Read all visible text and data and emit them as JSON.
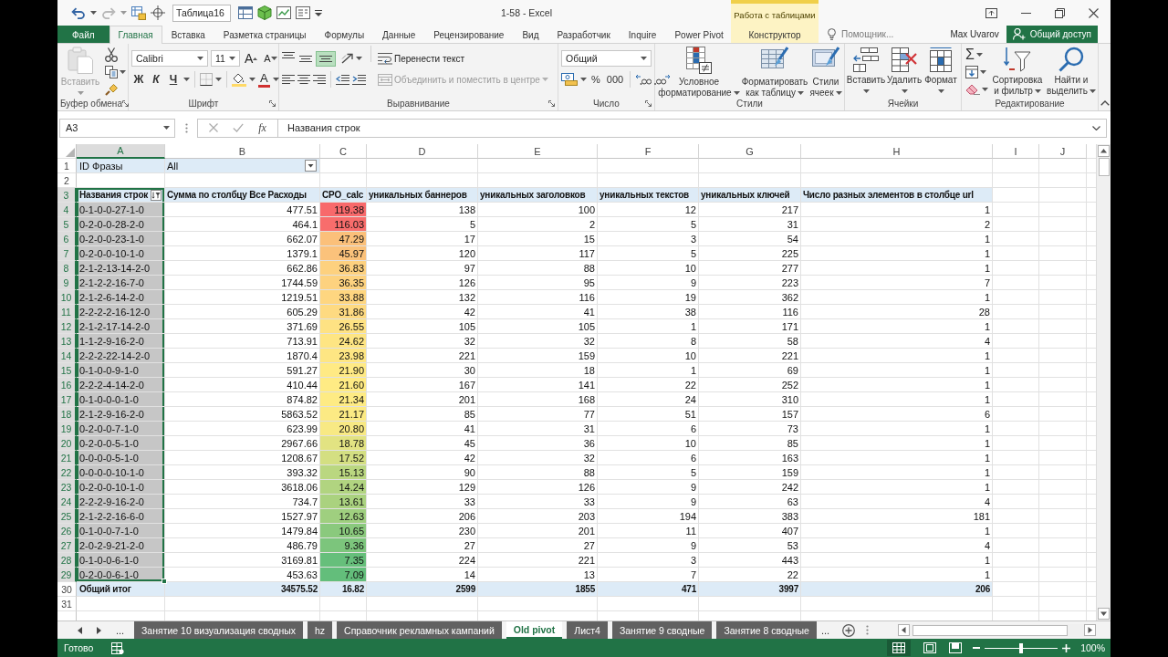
{
  "quick_access": {
    "name_box": "Таблица16",
    "redo_disabled": true
  },
  "window": {
    "title": "1-58 - Excel",
    "context_header": "Работа с таблицами"
  },
  "ribbon_tabs": [
    {
      "label": "Файл",
      "kind": "file",
      "selected": false
    },
    {
      "label": "Главная",
      "kind": "tab",
      "selected": true
    },
    {
      "label": "Вставка",
      "kind": "tab",
      "selected": false
    },
    {
      "label": "Разметка страницы",
      "kind": "tab",
      "selected": false
    },
    {
      "label": "Формулы",
      "kind": "tab",
      "selected": false
    },
    {
      "label": "Данные",
      "kind": "tab",
      "selected": false
    },
    {
      "label": "Рецензирование",
      "kind": "tab",
      "selected": false
    },
    {
      "label": "Вид",
      "kind": "tab",
      "selected": false
    },
    {
      "label": "Разработчик",
      "kind": "tab",
      "selected": false
    },
    {
      "label": "Inquire",
      "kind": "tab",
      "selected": false
    },
    {
      "label": "Power Pivot",
      "kind": "tab",
      "selected": false
    },
    {
      "label": "Конструктор",
      "kind": "context",
      "selected": false
    }
  ],
  "tell_me": {
    "placeholder": "Помощник..."
  },
  "account": {
    "user": "Max Uvarov",
    "share": "Общий доступ"
  },
  "ribbon": {
    "clipboard": {
      "label": "Буфер обмена",
      "paste": {
        "label": "Вставить",
        "disabled": true
      }
    },
    "font": {
      "label": "Шрифт",
      "family": "Calibri",
      "size": "11",
      "grow": "A",
      "shrink": "A",
      "text_styles": [
        {
          "kind": "bold",
          "label": "Ж"
        },
        {
          "kind": "italic",
          "label": "К"
        },
        {
          "kind": "underline",
          "label": "Ч"
        }
      ],
      "font_color": "A"
    },
    "alignment": {
      "label": "Выравнивание",
      "vertical": [
        {
          "kind": "top",
          "selected": false
        },
        {
          "kind": "middle",
          "selected": false
        },
        {
          "kind": "bottom",
          "selected": true
        }
      ],
      "wrap": "Перенести текст",
      "merge": {
        "label": "Объединить и поместить в центре",
        "disabled": true
      }
    },
    "number": {
      "label": "Число",
      "format": "Общий",
      "percent": "%",
      "thousands": "000"
    },
    "styles": {
      "label": "Стили",
      "buttons": [
        {
          "kind": "conditional",
          "label": "Условное форматирование"
        },
        {
          "kind": "table",
          "label": "Форматировать как таблицу"
        },
        {
          "kind": "cell",
          "label": "Стили ячеек"
        }
      ]
    },
    "cells": {
      "label": "Ячейки",
      "buttons": [
        {
          "kind": "insert",
          "label": "Вставить"
        },
        {
          "kind": "delete",
          "label": "Удалить"
        },
        {
          "kind": "format",
          "label": "Формат"
        }
      ]
    },
    "editing": {
      "label": "Редактирование",
      "autosum": "Σ",
      "buttons": [
        {
          "kind": "sort",
          "label": "Сортировка и фильтр"
        },
        {
          "kind": "find",
          "label": "Найти и выделить"
        }
      ]
    }
  },
  "formula_bar": {
    "name_box": "A3",
    "function_label": "fx",
    "formula": "Названия строк"
  },
  "sheet": {
    "columns": [
      {
        "label": "A",
        "selected": true
      },
      {
        "label": "B",
        "selected": false
      },
      {
        "label": "C",
        "selected": false
      },
      {
        "label": "D",
        "selected": false
      },
      {
        "label": "E",
        "selected": false
      },
      {
        "label": "F",
        "selected": false
      },
      {
        "label": "G",
        "selected": false
      },
      {
        "label": "H",
        "selected": false
      },
      {
        "label": "I",
        "selected": false
      },
      {
        "label": "J",
        "selected": false
      }
    ],
    "rows": [
      {
        "kind": "filter",
        "number": "1",
        "selected": false,
        "cells": [
          "ID Фразы",
          "All"
        ]
      },
      {
        "kind": "blank",
        "number": "2",
        "selected": false
      },
      {
        "kind": "header",
        "number": "3",
        "selected": true,
        "cells": [
          "Названия строк",
          "Сумма по столбцу Все Расходы",
          "CPO_calc",
          "уникальных баннеров",
          "уникальных заголовков",
          "уникальных текстов",
          "уникальных ключей",
          "Число разных элементов в столбце url"
        ]
      },
      {
        "kind": "data",
        "number": "4",
        "selected": true,
        "color": "#f8696b",
        "cells": [
          "0-1-0-0-27-1-0",
          "477.51",
          "119.38",
          "138",
          "100",
          "12",
          "217",
          "1"
        ]
      },
      {
        "kind": "data",
        "number": "5",
        "selected": true,
        "color": "#f86d6c",
        "cells": [
          "0-2-0-0-28-2-0",
          "464.1",
          "116.03",
          "5",
          "2",
          "5",
          "31",
          "2"
        ]
      },
      {
        "kind": "data",
        "number": "6",
        "selected": true,
        "color": "#fbc07a",
        "cells": [
          "0-2-0-0-23-1-0",
          "662.07",
          "47.29",
          "17",
          "15",
          "3",
          "54",
          "1"
        ]
      },
      {
        "kind": "data",
        "number": "7",
        "selected": true,
        "color": "#fbc27b",
        "cells": [
          "0-2-0-0-10-1-0",
          "1379.1",
          "45.97",
          "120",
          "117",
          "5",
          "225",
          "1"
        ]
      },
      {
        "kind": "data",
        "number": "8",
        "selected": true,
        "color": "#fdd17f",
        "cells": [
          "2-1-2-13-14-2-0",
          "662.86",
          "36.83",
          "97",
          "88",
          "10",
          "277",
          "1"
        ]
      },
      {
        "kind": "data",
        "number": "9",
        "selected": true,
        "color": "#fdd27f",
        "cells": [
          "2-1-2-2-16-7-0",
          "1744.59",
          "36.35",
          "126",
          "95",
          "9",
          "223",
          "7"
        ]
      },
      {
        "kind": "data",
        "number": "10",
        "selected": true,
        "color": "#fed680",
        "cells": [
          "2-1-2-6-14-2-0",
          "1219.51",
          "33.88",
          "132",
          "116",
          "19",
          "362",
          "1"
        ]
      },
      {
        "kind": "data",
        "number": "11",
        "selected": true,
        "color": "#feda81",
        "cells": [
          "2-2-2-2-16-12-0",
          "605.29",
          "31.86",
          "42",
          "41",
          "38",
          "116",
          "28"
        ]
      },
      {
        "kind": "data",
        "number": "12",
        "selected": true,
        "color": "#fee283",
        "cells": [
          "2-1-2-17-14-2-0",
          "371.69",
          "26.55",
          "105",
          "105",
          "1",
          "171",
          "1"
        ]
      },
      {
        "kind": "data",
        "number": "13",
        "selected": true,
        "color": "#fee583",
        "cells": [
          "1-1-2-9-16-2-0",
          "713.91",
          "24.62",
          "32",
          "32",
          "8",
          "58",
          "4"
        ]
      },
      {
        "kind": "data",
        "number": "14",
        "selected": true,
        "color": "#fee683",
        "cells": [
          "2-2-2-22-14-2-0",
          "1870.4",
          "23.98",
          "221",
          "159",
          "10",
          "221",
          "1"
        ]
      },
      {
        "kind": "data",
        "number": "15",
        "selected": true,
        "color": "#ffea84",
        "cells": [
          "0-1-0-0-9-1-0",
          "591.27",
          "21.90",
          "30",
          "18",
          "1",
          "69",
          "1"
        ]
      },
      {
        "kind": "data",
        "number": "16",
        "selected": true,
        "color": "#ffeb84",
        "cells": [
          "2-2-2-4-14-2-0",
          "410.44",
          "21.60",
          "167",
          "141",
          "22",
          "252",
          "1"
        ]
      },
      {
        "kind": "data",
        "number": "17",
        "selected": true,
        "color": "#feeb84",
        "cells": [
          "0-1-0-0-0-1-0",
          "874.82",
          "21.34",
          "201",
          "168",
          "24",
          "310",
          "1"
        ]
      },
      {
        "kind": "data",
        "number": "18",
        "selected": true,
        "color": "#fcea84",
        "cells": [
          "2-1-2-9-16-2-0",
          "5863.52",
          "21.17",
          "85",
          "77",
          "51",
          "157",
          "6"
        ]
      },
      {
        "kind": "data",
        "number": "19",
        "selected": true,
        "color": "#f8e984",
        "cells": [
          "0-2-0-0-7-1-0",
          "623.99",
          "20.80",
          "41",
          "31",
          "6",
          "73",
          "1"
        ]
      },
      {
        "kind": "data",
        "number": "20",
        "selected": true,
        "color": "#e2e382",
        "cells": [
          "0-2-0-0-5-1-0",
          "2967.66",
          "18.78",
          "45",
          "36",
          "10",
          "85",
          "1"
        ]
      },
      {
        "kind": "data",
        "number": "21",
        "selected": true,
        "color": "#d4df82",
        "cells": [
          "0-0-0-0-5-1-0",
          "1208.67",
          "17.52",
          "42",
          "32",
          "6",
          "163",
          "1"
        ]
      },
      {
        "kind": "data",
        "number": "22",
        "selected": true,
        "color": "#bad780",
        "cells": [
          "0-0-0-0-10-1-0",
          "393.32",
          "15.13",
          "90",
          "88",
          "5",
          "159",
          "1"
        ]
      },
      {
        "kind": "data",
        "number": "23",
        "selected": true,
        "color": "#b1d480",
        "cells": [
          "0-2-0-0-10-1-0",
          "3618.06",
          "14.24",
          "129",
          "126",
          "9",
          "242",
          "1"
        ]
      },
      {
        "kind": "data",
        "number": "24",
        "selected": true,
        "color": "#aad27f",
        "cells": [
          "2-2-2-9-16-2-0",
          "734.7",
          "13.61",
          "33",
          "33",
          "9",
          "63",
          "4"
        ]
      },
      {
        "kind": "data",
        "number": "25",
        "selected": true,
        "color": "#9fcf7f",
        "cells": [
          "2-1-2-2-16-6-0",
          "1527.97",
          "12.63",
          "206",
          "203",
          "194",
          "383",
          "181"
        ]
      },
      {
        "kind": "data",
        "number": "26",
        "selected": true,
        "color": "#8ac97d",
        "cells": [
          "0-1-0-0-7-1-0",
          "1479.84",
          "10.65",
          "230",
          "201",
          "11",
          "407",
          "1"
        ]
      },
      {
        "kind": "data",
        "number": "27",
        "selected": true,
        "color": "#7cc57c",
        "cells": [
          "2-0-2-9-21-2-0",
          "486.79",
          "9.36",
          "27",
          "27",
          "9",
          "53",
          "4"
        ]
      },
      {
        "kind": "data",
        "number": "28",
        "selected": true,
        "color": "#66bf7b",
        "cells": [
          "0-1-0-0-6-1-0",
          "3169.81",
          "7.35",
          "224",
          "221",
          "3",
          "443",
          "1"
        ]
      },
      {
        "kind": "data",
        "number": "29",
        "selected": true,
        "color": "#63be7b",
        "cells": [
          "0-2-0-0-6-1-0",
          "453.63",
          "7.09",
          "14",
          "13",
          "7",
          "22",
          "1"
        ]
      },
      {
        "kind": "total",
        "number": "30",
        "selected": false,
        "cells": [
          "Общий итог",
          "34575.52",
          "16.82",
          "2599",
          "1855",
          "471",
          "3997",
          "206"
        ]
      },
      {
        "kind": "blank",
        "number": "31",
        "selected": false
      }
    ]
  },
  "sheet_tabs": [
    {
      "label": "Занятие 10 визуализация сводных",
      "selected": false
    },
    {
      "label": "hz",
      "selected": false
    },
    {
      "label": "Справочник рекламных кампаний",
      "selected": false
    },
    {
      "label": "Old pivot",
      "selected": true
    },
    {
      "label": "Лист4",
      "selected": false
    },
    {
      "label": "Занятие 9 сводные",
      "selected": false
    },
    {
      "label": "Занятие 8 сводные",
      "selected": false
    }
  ],
  "tab_overflow": [
    "...",
    "..."
  ],
  "status_bar": {
    "text": "Готово",
    "views": [
      {
        "kind": "normal",
        "selected": true
      },
      {
        "kind": "page_layout",
        "selected": false
      },
      {
        "kind": "page_break",
        "selected": false
      }
    ],
    "zoom": {
      "level": 0.5,
      "reading": "100%"
    }
  }
}
